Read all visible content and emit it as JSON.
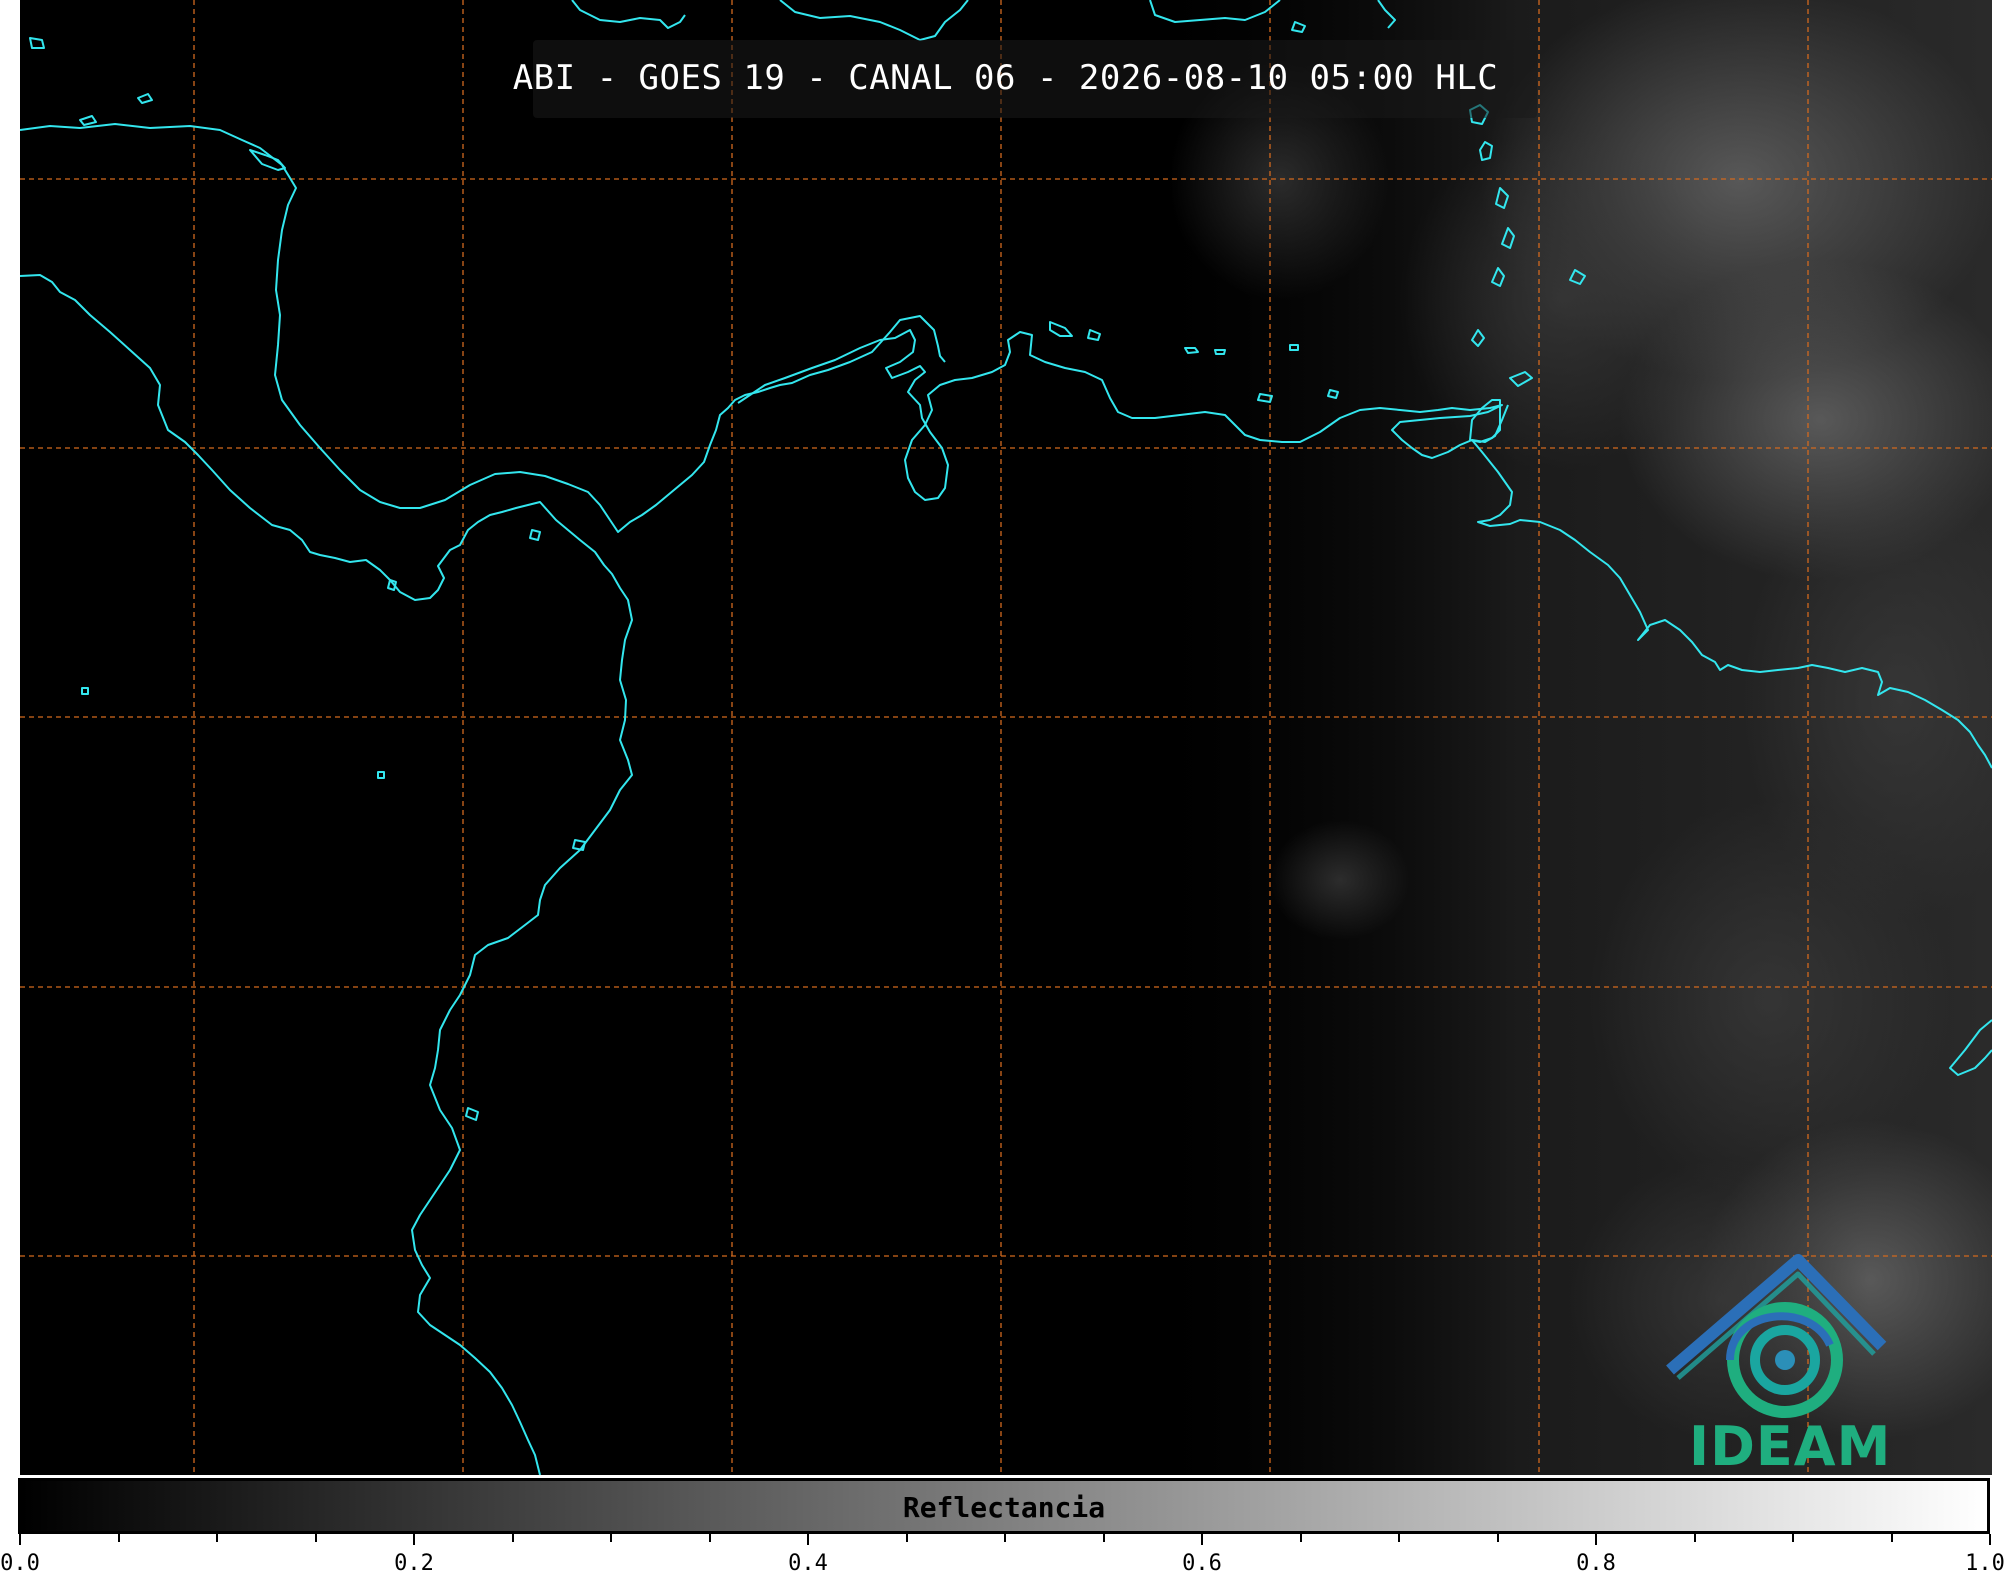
{
  "title": "ABI - GOES 19 - CANAL 06 - 2026-08-10 05:00 HLC",
  "colorbar": {
    "label": "Reflectancia",
    "range": [
      0.0,
      1.0
    ],
    "ticks": [
      "0.0",
      "0.2",
      "0.4",
      "0.6",
      "0.8",
      "1.0"
    ],
    "gradient": [
      "#000000",
      "#ffffff"
    ]
  },
  "logo": {
    "text": "IDEAM",
    "colors": [
      "#2b5fb0",
      "#1fae7f"
    ]
  },
  "map": {
    "background": "#000000",
    "coastline_color": "#33e6ee",
    "gridline_color": "#d2691e",
    "gridline_style": "dashed"
  }
}
